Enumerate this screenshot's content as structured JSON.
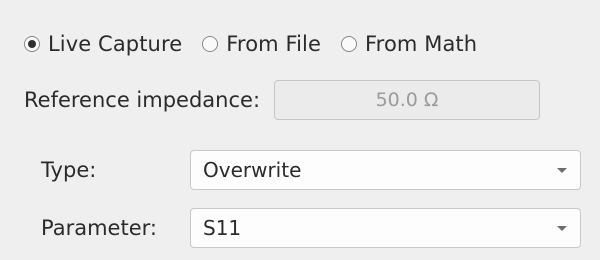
{
  "source": {
    "options": [
      {
        "label": "Live Capture",
        "selected": true
      },
      {
        "label": "From File",
        "selected": false
      },
      {
        "label": "From Math",
        "selected": false
      }
    ]
  },
  "impedance": {
    "label": "Reference impedance:",
    "value": "50.0 Ω"
  },
  "type": {
    "label": "Type:",
    "value": "Overwrite"
  },
  "parameter": {
    "label": "Parameter:",
    "value": "S11"
  }
}
